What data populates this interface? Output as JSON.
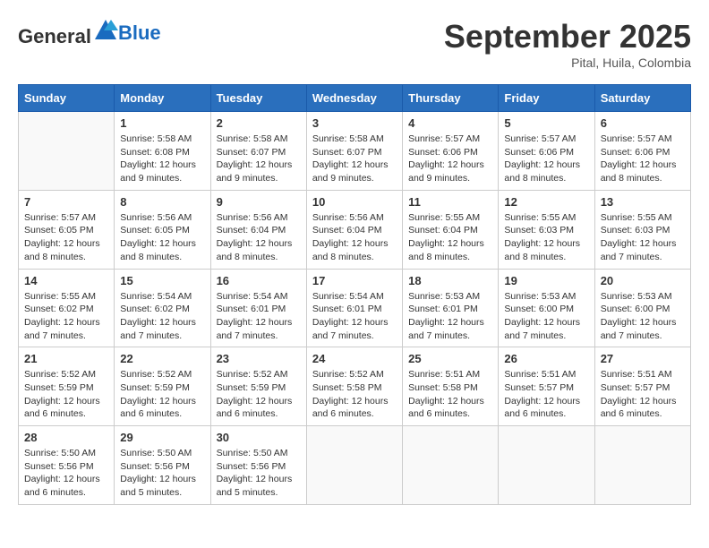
{
  "header": {
    "logo_general": "General",
    "logo_blue": "Blue",
    "month": "September 2025",
    "location": "Pital, Huila, Colombia"
  },
  "days_of_week": [
    "Sunday",
    "Monday",
    "Tuesday",
    "Wednesday",
    "Thursday",
    "Friday",
    "Saturday"
  ],
  "weeks": [
    [
      {
        "day": "",
        "info": ""
      },
      {
        "day": "1",
        "info": "Sunrise: 5:58 AM\nSunset: 6:08 PM\nDaylight: 12 hours\nand 9 minutes."
      },
      {
        "day": "2",
        "info": "Sunrise: 5:58 AM\nSunset: 6:07 PM\nDaylight: 12 hours\nand 9 minutes."
      },
      {
        "day": "3",
        "info": "Sunrise: 5:58 AM\nSunset: 6:07 PM\nDaylight: 12 hours\nand 9 minutes."
      },
      {
        "day": "4",
        "info": "Sunrise: 5:57 AM\nSunset: 6:06 PM\nDaylight: 12 hours\nand 9 minutes."
      },
      {
        "day": "5",
        "info": "Sunrise: 5:57 AM\nSunset: 6:06 PM\nDaylight: 12 hours\nand 8 minutes."
      },
      {
        "day": "6",
        "info": "Sunrise: 5:57 AM\nSunset: 6:06 PM\nDaylight: 12 hours\nand 8 minutes."
      }
    ],
    [
      {
        "day": "7",
        "info": "Sunrise: 5:57 AM\nSunset: 6:05 PM\nDaylight: 12 hours\nand 8 minutes."
      },
      {
        "day": "8",
        "info": "Sunrise: 5:56 AM\nSunset: 6:05 PM\nDaylight: 12 hours\nand 8 minutes."
      },
      {
        "day": "9",
        "info": "Sunrise: 5:56 AM\nSunset: 6:04 PM\nDaylight: 12 hours\nand 8 minutes."
      },
      {
        "day": "10",
        "info": "Sunrise: 5:56 AM\nSunset: 6:04 PM\nDaylight: 12 hours\nand 8 minutes."
      },
      {
        "day": "11",
        "info": "Sunrise: 5:55 AM\nSunset: 6:04 PM\nDaylight: 12 hours\nand 8 minutes."
      },
      {
        "day": "12",
        "info": "Sunrise: 5:55 AM\nSunset: 6:03 PM\nDaylight: 12 hours\nand 8 minutes."
      },
      {
        "day": "13",
        "info": "Sunrise: 5:55 AM\nSunset: 6:03 PM\nDaylight: 12 hours\nand 7 minutes."
      }
    ],
    [
      {
        "day": "14",
        "info": "Sunrise: 5:55 AM\nSunset: 6:02 PM\nDaylight: 12 hours\nand 7 minutes."
      },
      {
        "day": "15",
        "info": "Sunrise: 5:54 AM\nSunset: 6:02 PM\nDaylight: 12 hours\nand 7 minutes."
      },
      {
        "day": "16",
        "info": "Sunrise: 5:54 AM\nSunset: 6:01 PM\nDaylight: 12 hours\nand 7 minutes."
      },
      {
        "day": "17",
        "info": "Sunrise: 5:54 AM\nSunset: 6:01 PM\nDaylight: 12 hours\nand 7 minutes."
      },
      {
        "day": "18",
        "info": "Sunrise: 5:53 AM\nSunset: 6:01 PM\nDaylight: 12 hours\nand 7 minutes."
      },
      {
        "day": "19",
        "info": "Sunrise: 5:53 AM\nSunset: 6:00 PM\nDaylight: 12 hours\nand 7 minutes."
      },
      {
        "day": "20",
        "info": "Sunrise: 5:53 AM\nSunset: 6:00 PM\nDaylight: 12 hours\nand 7 minutes."
      }
    ],
    [
      {
        "day": "21",
        "info": "Sunrise: 5:52 AM\nSunset: 5:59 PM\nDaylight: 12 hours\nand 6 minutes."
      },
      {
        "day": "22",
        "info": "Sunrise: 5:52 AM\nSunset: 5:59 PM\nDaylight: 12 hours\nand 6 minutes."
      },
      {
        "day": "23",
        "info": "Sunrise: 5:52 AM\nSunset: 5:59 PM\nDaylight: 12 hours\nand 6 minutes."
      },
      {
        "day": "24",
        "info": "Sunrise: 5:52 AM\nSunset: 5:58 PM\nDaylight: 12 hours\nand 6 minutes."
      },
      {
        "day": "25",
        "info": "Sunrise: 5:51 AM\nSunset: 5:58 PM\nDaylight: 12 hours\nand 6 minutes."
      },
      {
        "day": "26",
        "info": "Sunrise: 5:51 AM\nSunset: 5:57 PM\nDaylight: 12 hours\nand 6 minutes."
      },
      {
        "day": "27",
        "info": "Sunrise: 5:51 AM\nSunset: 5:57 PM\nDaylight: 12 hours\nand 6 minutes."
      }
    ],
    [
      {
        "day": "28",
        "info": "Sunrise: 5:50 AM\nSunset: 5:56 PM\nDaylight: 12 hours\nand 6 minutes."
      },
      {
        "day": "29",
        "info": "Sunrise: 5:50 AM\nSunset: 5:56 PM\nDaylight: 12 hours\nand 5 minutes."
      },
      {
        "day": "30",
        "info": "Sunrise: 5:50 AM\nSunset: 5:56 PM\nDaylight: 12 hours\nand 5 minutes."
      },
      {
        "day": "",
        "info": ""
      },
      {
        "day": "",
        "info": ""
      },
      {
        "day": "",
        "info": ""
      },
      {
        "day": "",
        "info": ""
      }
    ]
  ]
}
